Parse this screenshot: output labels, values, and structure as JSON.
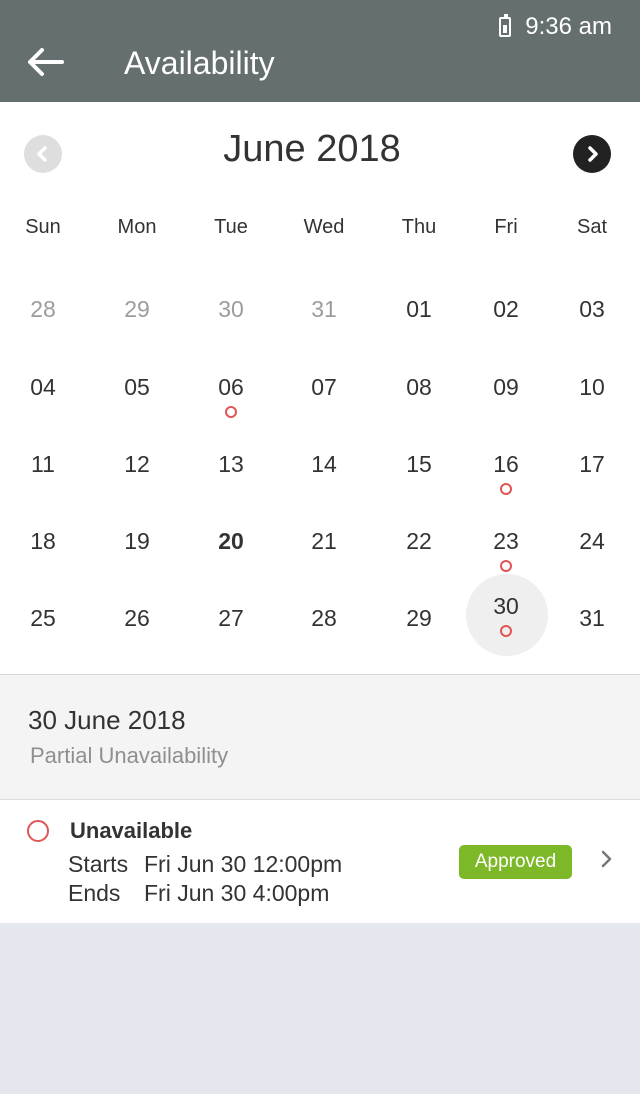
{
  "status_bar": {
    "time": "9:36 am",
    "icons": [
      "battery-icon"
    ]
  },
  "app_bar": {
    "title": "Availability",
    "back_icon": "arrow-left-icon"
  },
  "calendar": {
    "month_label": "June 2018",
    "weekdays": [
      "Sun",
      "Mon",
      "Tue",
      "Wed",
      "Thu",
      "Fri",
      "Sat"
    ],
    "weeks": [
      [
        {
          "d": "28",
          "muted": true
        },
        {
          "d": "29",
          "muted": true
        },
        {
          "d": "30",
          "muted": true
        },
        {
          "d": "31",
          "muted": true
        },
        {
          "d": "01"
        },
        {
          "d": "02"
        },
        {
          "d": "03"
        }
      ],
      [
        {
          "d": "04"
        },
        {
          "d": "05"
        },
        {
          "d": "06",
          "dot": true
        },
        {
          "d": "07"
        },
        {
          "d": "08"
        },
        {
          "d": "09"
        },
        {
          "d": "10"
        }
      ],
      [
        {
          "d": "11"
        },
        {
          "d": "12"
        },
        {
          "d": "13"
        },
        {
          "d": "14"
        },
        {
          "d": "15"
        },
        {
          "d": "16",
          "dot": true
        },
        {
          "d": "17"
        }
      ],
      [
        {
          "d": "18"
        },
        {
          "d": "19"
        },
        {
          "d": "20",
          "today": true
        },
        {
          "d": "21"
        },
        {
          "d": "22"
        },
        {
          "d": "23",
          "dot": true
        },
        {
          "d": "24"
        }
      ],
      [
        {
          "d": "25"
        },
        {
          "d": "26"
        },
        {
          "d": "27"
        },
        {
          "d": "28"
        },
        {
          "d": "29"
        },
        {
          "d": "30",
          "dot": true,
          "selected": true
        },
        {
          "d": "31"
        }
      ]
    ],
    "colors": {
      "dot": "#e05555",
      "selected_bg": "#efefef"
    }
  },
  "detail": {
    "date_title": "30 June 2018",
    "subtitle": "Partial Unavailability"
  },
  "event": {
    "type": "Unavailable",
    "starts_label": "Starts",
    "starts_value": "Fri Jun 30 12:00pm",
    "ends_label": "Ends",
    "ends_value": "Fri Jun 30 4:00pm",
    "status": "Approved",
    "status_color": "#7cb828"
  }
}
